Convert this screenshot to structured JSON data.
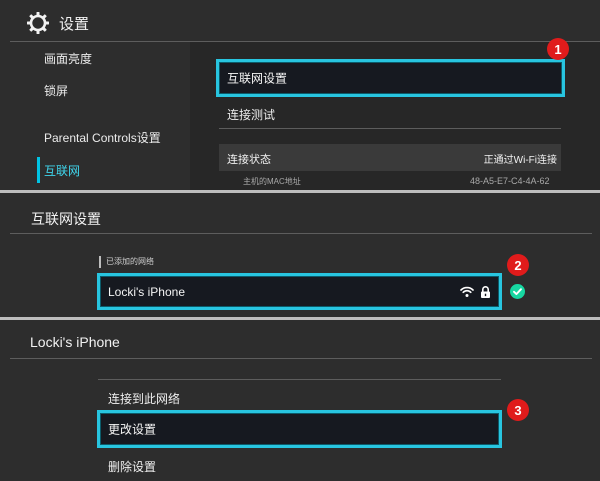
{
  "settings": {
    "title": "设置",
    "sidebar": [
      {
        "label": "画面亮度"
      },
      {
        "label": "锁屏"
      },
      {
        "label": "Parental Controls设置"
      },
      {
        "label": "互联网",
        "active": true
      }
    ],
    "main": {
      "internet_settings": "互联网设置",
      "connection_test": "连接测试",
      "connection_status_label": "连接状态",
      "connection_status_value": "正通过Wi-Fi连接",
      "mac_label": "主机的MAC地址",
      "mac_value": "48-A5-E7-C4-4A-62"
    }
  },
  "internet": {
    "title": "互联网设置",
    "registered_label": "已添加的网络",
    "network_name": "Locki's iPhone",
    "icons": [
      "wifi-icon",
      "lock-icon",
      "connected-check-icon"
    ]
  },
  "network": {
    "title": "Locki's iPhone",
    "options": [
      {
        "label": "连接到此网络"
      },
      {
        "label": "更改设置",
        "focused": true
      },
      {
        "label": "删除设置"
      }
    ]
  },
  "steps": [
    "1",
    "2",
    "3"
  ],
  "colors": {
    "focus": "#28c5e0",
    "active": "#00c3e3",
    "badge": "#e01b1b",
    "check": "#17d7a1",
    "background": "#2d2d2d"
  }
}
